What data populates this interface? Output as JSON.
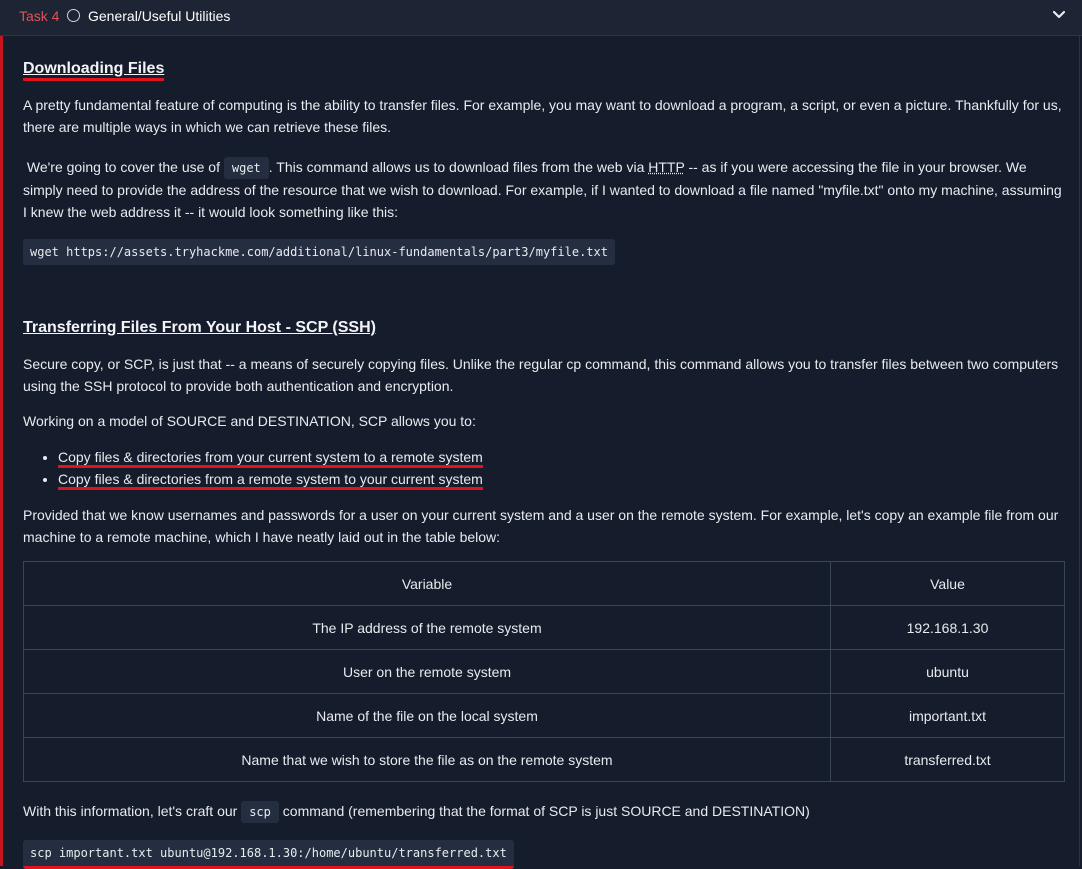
{
  "task": {
    "label": "Task 4",
    "title": "General/Useful Utilities"
  },
  "section1": {
    "heading": "Downloading Files",
    "para1": "A pretty fundamental feature of computing is the ability to transfer files. For example, you may want to download a program, a script, or even a picture. Thankfully for us, there are multiple ways in which we can retrieve these files.",
    "para2_a": "We're going to cover the use of",
    "para2_code": "wget",
    "para2_b": ". This command allows us to download files from the web via",
    "para2_abbr": "HTTP",
    "para2_c": "-- as if you were accessing the file in your browser. We simply need to provide the address of the resource that we wish to download. For example, if I wanted to download a file named \"myfile.txt\" onto my machine, assuming I knew the web address it -- it would look something like this:",
    "code": "wget https://assets.tryhackme.com/additional/linux-fundamentals/part3/myfile.txt"
  },
  "section2": {
    "heading": "Transferring Files From Your Host - SCP (SSH)",
    "para1": "Secure copy, or SCP, is just that -- a means of securely copying files. Unlike the regular cp command, this command allows you to transfer files between two computers using the SSH protocol to provide both authentication and encryption.",
    "para2": "Working on a model of SOURCE and DESTINATION, SCP allows you to:",
    "bullets": [
      "Copy files & directories from your current system to a remote system",
      "Copy files & directories from a remote system to your current system"
    ],
    "para3": "Provided that we know usernames and passwords for a user on your current system and a user on the remote system. For example, let's copy an example file from our machine to a remote machine, which I have neatly laid out in the table below:",
    "table": {
      "headers": [
        "Variable",
        "Value"
      ],
      "rows": [
        [
          "The IP address of the remote system",
          "192.168.1.30"
        ],
        [
          "User on the remote system",
          "ubuntu"
        ],
        [
          "Name of the file on the local system",
          "important.txt"
        ],
        [
          "Name that we wish to store the file as on the remote system",
          "transferred.txt"
        ]
      ]
    },
    "para4_a": "With this information, let's craft our",
    "para4_code": "scp",
    "para4_b": "command (remembering that the format of SCP is just SOURCE and DESTINATION)",
    "code": "scp important.txt ubuntu@192.168.1.30:/home/ubuntu/transferred.txt"
  }
}
